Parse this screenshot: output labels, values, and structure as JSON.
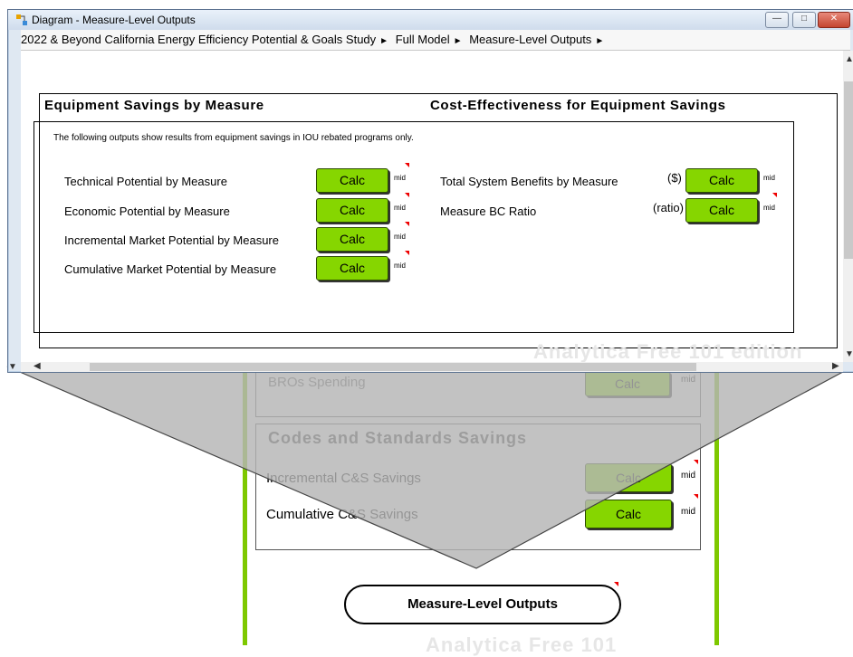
{
  "window": {
    "title": "Diagram - Measure-Level Outputs",
    "breadcrumb": [
      "2022 & Beyond California Energy Efficiency Potential & Goals Study",
      "Full Model",
      "Measure-Level Outputs"
    ]
  },
  "popup": {
    "header_left": "Equipment Savings by Measure",
    "header_right": "Cost-Effectiveness for Equipment Savings",
    "note": "The following outputs show results from equipment savings in IOU rebated programs only.",
    "left_items": [
      {
        "label": "Technical Potential by Measure",
        "button": "Calc",
        "tag": "mid"
      },
      {
        "label": "Economic Potential by Measure",
        "button": "Calc",
        "tag": "mid"
      },
      {
        "label": "Incremental Market Potential by Measure",
        "button": "Calc",
        "tag": "mid"
      },
      {
        "label": "Cumulative Market Potential by Measure",
        "button": "Calc",
        "tag": "mid"
      }
    ],
    "right_items": [
      {
        "label": "Total System Benefits by Measure",
        "unit": "($)",
        "button": "Calc",
        "tag": "mid"
      },
      {
        "label": "Measure BC Ratio",
        "unit": "(ratio)",
        "button": "Calc",
        "tag": "mid"
      }
    ],
    "watermark": "Analytica Free 101 edition"
  },
  "background": {
    "top_item": {
      "label": "BROs Spending",
      "button": "Calc",
      "tag": "mid"
    },
    "cs_section": {
      "title": "Codes and Standards Savings",
      "items": [
        {
          "label": "Incremental C&S Savings",
          "button": "Calc",
          "tag": "mid"
        },
        {
          "label": "Cumulative C&S Savings",
          "button": "Calc",
          "tag": "mid"
        }
      ]
    },
    "bubble_label": "Measure-Level Outputs",
    "watermark": "Analytica Free 101"
  },
  "colors": {
    "calc_green": "#86d600",
    "panel_green": "#7ec800",
    "funnel_gray": "#b4b4b4"
  }
}
